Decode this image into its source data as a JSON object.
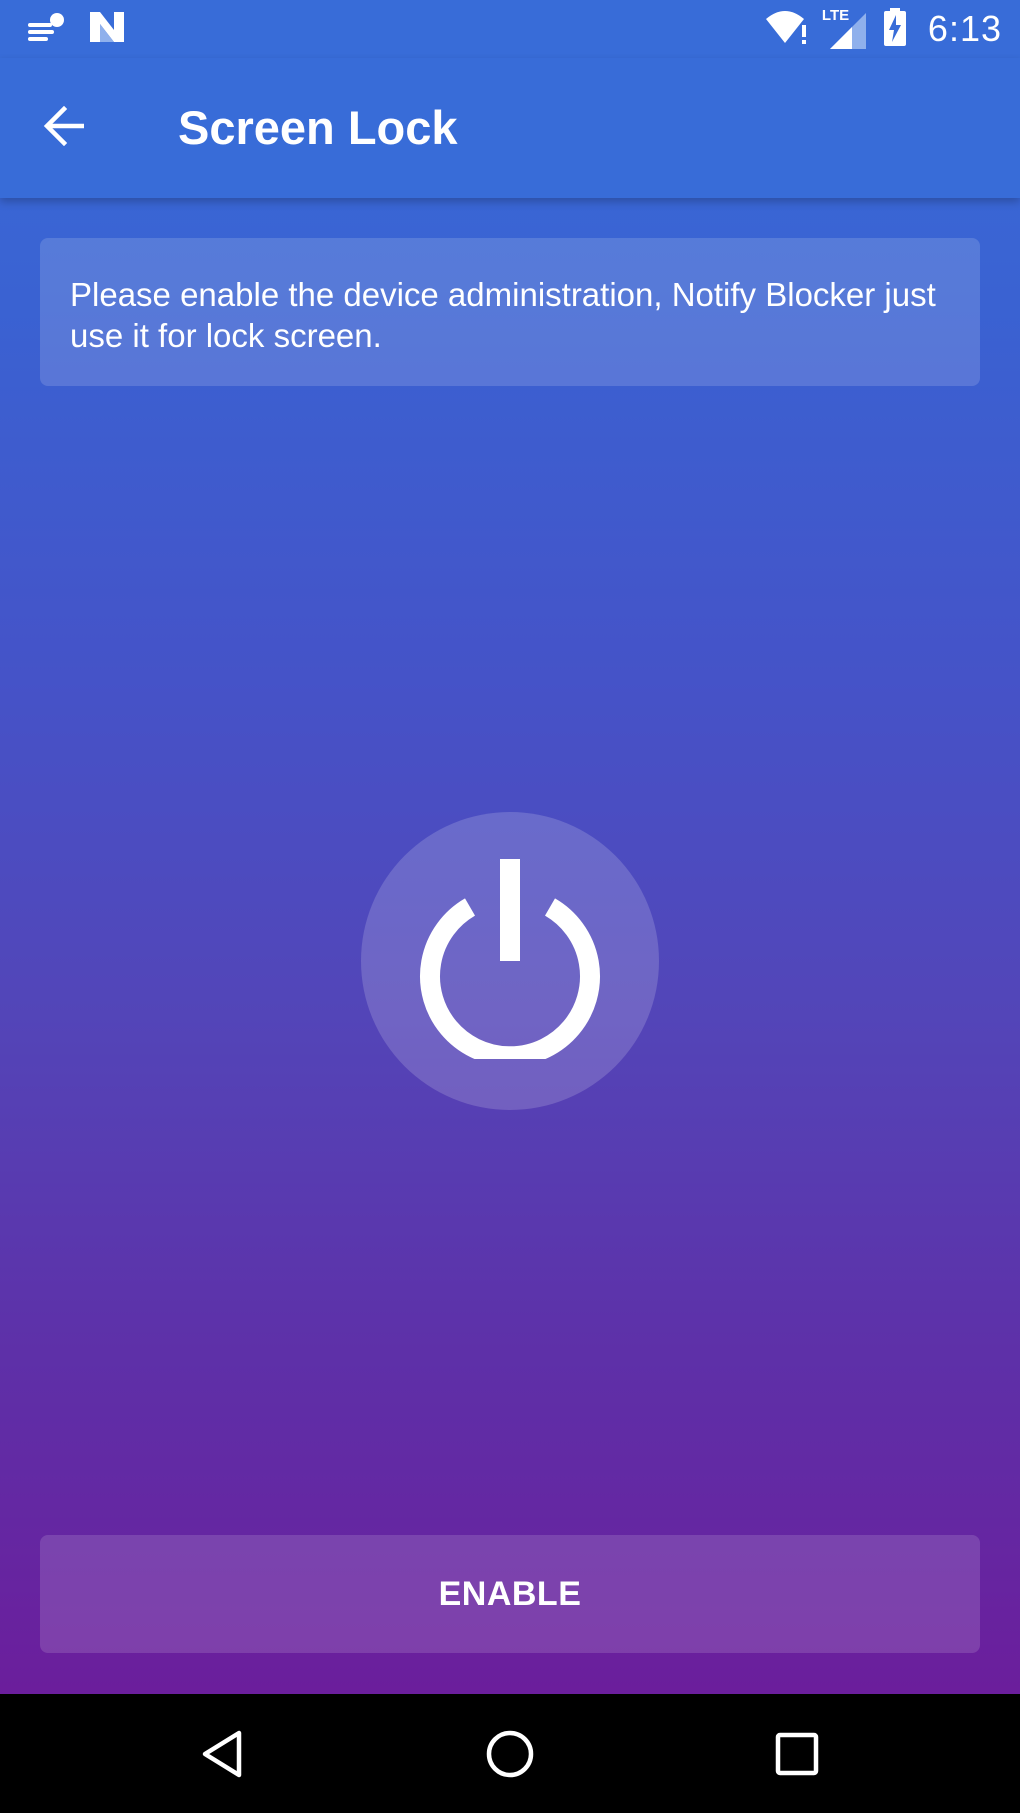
{
  "status_bar": {
    "time": "6:13",
    "network_label": "LTE",
    "icons": [
      "notification-icon",
      "n-logo-icon",
      "wifi-icon",
      "signal-icon",
      "battery-charging-icon"
    ]
  },
  "app_bar": {
    "title": "Screen Lock",
    "back_icon": "arrow-back-icon"
  },
  "info_card": {
    "text": "Please enable the device administration, Notify Blocker just use it for lock screen."
  },
  "center_icon": "power-icon",
  "enable_button": {
    "label": "ENABLE"
  },
  "nav_bar": {
    "icons": [
      "nav-back-icon",
      "nav-home-icon",
      "nav-recents-icon"
    ]
  },
  "colors": {
    "app_bar": "#386CD8",
    "gradient_top": "#386CD8",
    "gradient_bottom": "#6B1E9C",
    "text": "#FFFFFF"
  }
}
